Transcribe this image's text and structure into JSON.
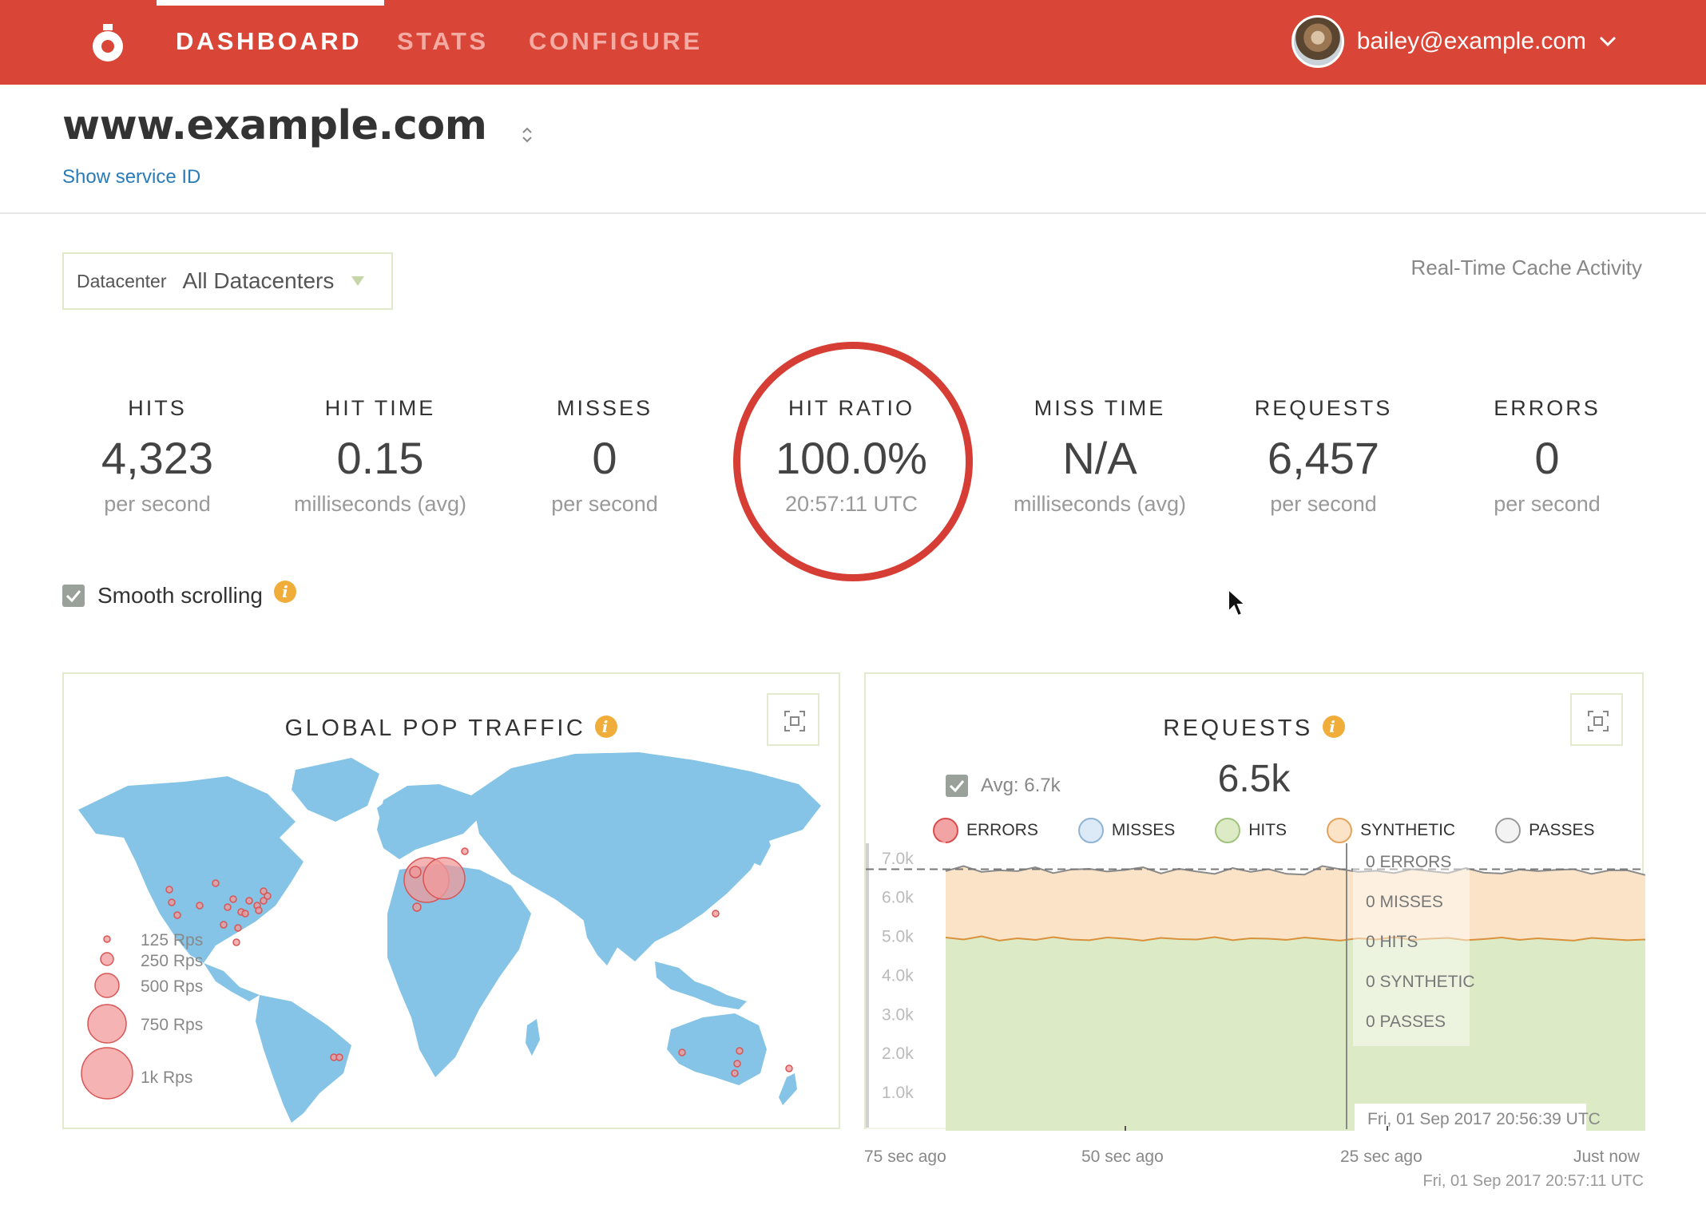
{
  "nav": {
    "items": [
      {
        "label": "DASHBOARD",
        "active": true
      },
      {
        "label": "STATS",
        "active": false
      },
      {
        "label": "CONFIGURE",
        "active": false
      }
    ],
    "user_email": "baileyexample.com",
    "user_email_full": "bailey@example.com"
  },
  "service": {
    "name": "www.example.com",
    "show_id": "Show service ID"
  },
  "datacenter": {
    "label": "Datacenter",
    "value": "All Datacenters"
  },
  "realtime_label": "Real-Time Cache Activity",
  "stats": [
    {
      "label": "HITS",
      "value": "4,323",
      "unit": "per second"
    },
    {
      "label": "HIT TIME",
      "value": "0.15",
      "unit": "milliseconds (avg)"
    },
    {
      "label": "MISSES",
      "value": "0",
      "unit": "per second"
    },
    {
      "label": "HIT RATIO",
      "value": "100.0%",
      "unit": "20:57:11 UTC"
    },
    {
      "label": "MISS TIME",
      "value": "N/A",
      "unit": "milliseconds (avg)"
    },
    {
      "label": "REQUESTS",
      "value": "6,457",
      "unit": "per second"
    },
    {
      "label": "ERRORS",
      "value": "0",
      "unit": "per second"
    }
  ],
  "smooth_scrolling": {
    "label": "Smooth scrolling",
    "checked": true
  },
  "info_glyph": "i",
  "map_panel": {
    "title": "GLOBAL POP TRAFFIC",
    "scale": [
      "125 Rps",
      "250 Rps",
      "500 Rps",
      "750 Rps",
      "1k Rps"
    ]
  },
  "requests_panel": {
    "title": "REQUESTS",
    "avg_label": "Avg: 6.7k",
    "current": "6.5k",
    "legend": [
      {
        "label": "ERRORS",
        "color": "#f2a3a3",
        "border": "#d94d4d"
      },
      {
        "label": "MISSES",
        "color": "#dbeaf6",
        "border": "#8fb4d3"
      },
      {
        "label": "HITS",
        "color": "#dcebc6",
        "border": "#9fc27d"
      },
      {
        "label": "SYNTHETIC",
        "color": "#fbe3c7",
        "border": "#e4a35c"
      },
      {
        "label": "PASSES",
        "color": "#f3f3f3",
        "border": "#9a9a9a"
      }
    ],
    "tooltip": [
      "0 ERRORS",
      "0 MISSES",
      "0 HITS",
      "0 SYNTHETIC",
      "0 PASSES"
    ],
    "hover_time": "Fri, 01 Sep 2017 20:56:39 UTC",
    "footer_time": "Fri, 01 Sep 2017 20:57:11 UTC"
  },
  "chart_data": {
    "type": "area",
    "title": "REQUESTS",
    "x": [
      "75 sec ago",
      "50 sec ago",
      "25 sec ago",
      "Just now"
    ],
    "yticks": [
      "1.0k",
      "2.0k",
      "3.0k",
      "4.0k",
      "5.0k",
      "6.0k",
      "7.0k"
    ],
    "ylim": [
      0,
      7200
    ],
    "series": [
      {
        "name": "HITS",
        "color": "#dcebc6",
        "values": [
          4950,
          4900,
          4980,
          4870,
          4930,
          4890,
          4960,
          4900,
          4880,
          4950,
          4920,
          4870,
          4940,
          4910,
          4900,
          4960,
          4880,
          4930,
          4920,
          4890,
          4950,
          4910,
          4870,
          4930,
          4900,
          4960,
          4890,
          4920,
          4940,
          4880,
          4910,
          4950,
          4890,
          4930,
          4900,
          4870,
          4940,
          4910,
          4880,
          4900
        ]
      },
      {
        "name": "SYNTHETIC",
        "color": "#fbe3c7",
        "values": [
          1700,
          1880,
          1650,
          1800,
          1720,
          1860,
          1640,
          1790,
          1830,
          1690,
          1760,
          1880,
          1650,
          1800,
          1740,
          1620,
          1850,
          1700,
          1780,
          1690,
          1610,
          1870,
          1830,
          1700,
          1760,
          1640,
          1810,
          1730,
          1660,
          1850,
          1700,
          1640,
          1800,
          1720,
          1780,
          1830,
          1640,
          1760,
          1790,
          1650
        ]
      }
    ],
    "avg": 6700,
    "grid": false,
    "legend_position": "top"
  }
}
